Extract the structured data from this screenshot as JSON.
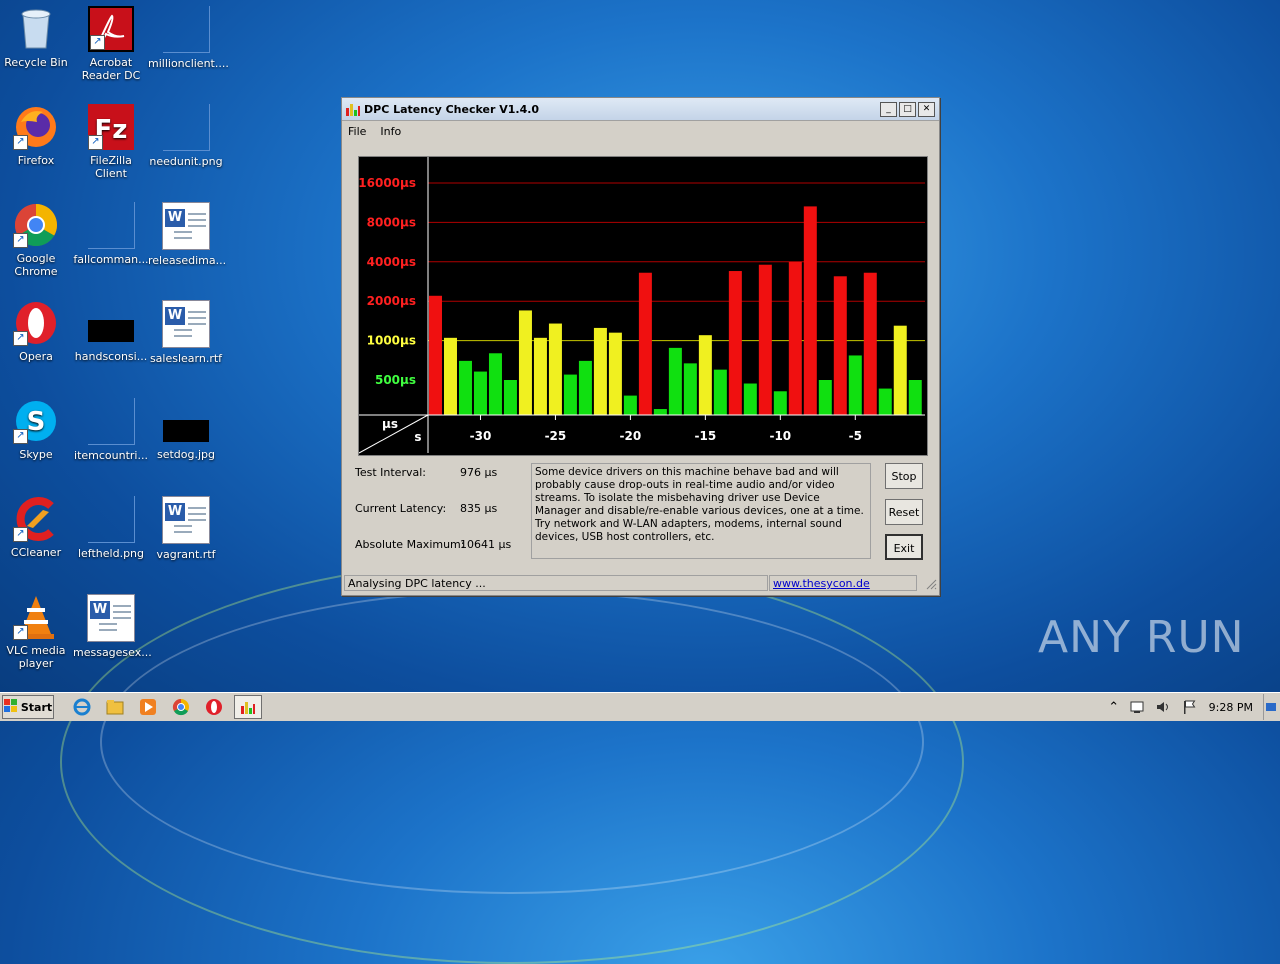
{
  "desktop": {
    "icons": [
      {
        "label": "Recycle Bin"
      },
      {
        "label": "Acrobat Reader DC"
      },
      {
        "label": "millionclient...."
      },
      {
        "label": "Firefox"
      },
      {
        "label": "FileZilla Client"
      },
      {
        "label": "needunit.png"
      },
      {
        "label": "Google Chrome"
      },
      {
        "label": "fallcomman..."
      },
      {
        "label": "releasedima..."
      },
      {
        "label": "Opera"
      },
      {
        "label": "handsconsi..."
      },
      {
        "label": "saleslearn.rtf"
      },
      {
        "label": "Skype"
      },
      {
        "label": "itemcountri..."
      },
      {
        "label": "setdog.jpg"
      },
      {
        "label": "CCleaner"
      },
      {
        "label": "leftheld.png"
      },
      {
        "label": "vagrant.rtf"
      },
      {
        "label": "VLC media player"
      },
      {
        "label": "messagesex..."
      }
    ],
    "watermark": "ANY RUN"
  },
  "window": {
    "title": "DPC Latency Checker V1.4.0",
    "menu": {
      "file": "File",
      "info": "Info"
    },
    "stats": {
      "test_interval_label": "Test Interval:",
      "test_interval_value": "976 µs",
      "current_latency_label": "Current Latency:",
      "current_latency_value": "835 µs",
      "absolute_max_label": "Absolute Maximum:",
      "absolute_max_value": "10641 µs"
    },
    "message": "Some device drivers on this machine behave bad and will probably cause drop-outs in real-time audio and/or video streams. To isolate the misbehaving driver use Device Manager and disable/re-enable various devices, one at a time. Try network and W-LAN adapters, modems, internal sound devices, USB host controllers, etc.",
    "buttons": {
      "stop": "Stop",
      "reset": "Reset",
      "exit": "Exit"
    },
    "status": "Analysing DPC latency ...",
    "link": "www.thesycon.de"
  },
  "chart_data": {
    "type": "bar",
    "y_tick_labels": [
      {
        "label": "16000µs",
        "value": 16000,
        "color": "#ff2020"
      },
      {
        "label": "8000µs",
        "value": 8000,
        "color": "#ff2020"
      },
      {
        "label": "4000µs",
        "value": 4000,
        "color": "#ff2020"
      },
      {
        "label": "2000µs",
        "value": 2000,
        "color": "#ff2020"
      },
      {
        "label": "1000µs",
        "value": 1000,
        "color": "#ffff40"
      },
      {
        "label": "500µs",
        "value": 500,
        "color": "#40ff40"
      }
    ],
    "x_tick_labels": [
      "-30",
      "-25",
      "-20",
      "-15",
      "-10",
      "-5"
    ],
    "x_ticks": [
      -30,
      -25,
      -20,
      -15,
      -10,
      -5
    ],
    "y_unit_label": "µs",
    "x_unit_label": "s",
    "x_range": [
      -33,
      0
    ],
    "scale": "log2",
    "bars": [
      {
        "x": -33,
        "value": 2200
      },
      {
        "x": -32,
        "value": 1050
      },
      {
        "x": -31,
        "value": 700
      },
      {
        "x": -30,
        "value": 580
      },
      {
        "x": -29,
        "value": 800
      },
      {
        "x": -28,
        "value": 500
      },
      {
        "x": -27,
        "value": 1700
      },
      {
        "x": -26,
        "value": 1050
      },
      {
        "x": -25,
        "value": 1350
      },
      {
        "x": -24,
        "value": 550
      },
      {
        "x": -23,
        "value": 700
      },
      {
        "x": -22,
        "value": 1250
      },
      {
        "x": -21,
        "value": 1150
      },
      {
        "x": -20,
        "value": 380
      },
      {
        "x": -19,
        "value": 3300
      },
      {
        "x": -18,
        "value": 300
      },
      {
        "x": -17,
        "value": 880
      },
      {
        "x": -16,
        "value": 670
      },
      {
        "x": -15,
        "value": 1100
      },
      {
        "x": -14,
        "value": 600
      },
      {
        "x": -13,
        "value": 3400
      },
      {
        "x": -12,
        "value": 470
      },
      {
        "x": -11,
        "value": 3800
      },
      {
        "x": -10,
        "value": 410
      },
      {
        "x": -9,
        "value": 4000
      },
      {
        "x": -8,
        "value": 10600
      },
      {
        "x": -7,
        "value": 500
      },
      {
        "x": -6,
        "value": 3100
      },
      {
        "x": -5,
        "value": 770
      },
      {
        "x": -4,
        "value": 3300
      },
      {
        "x": -3,
        "value": 430
      },
      {
        "x": -2,
        "value": 1300
      },
      {
        "x": -1,
        "value": 500
      }
    ],
    "color_thresholds": {
      "green_below": 1000,
      "yellow_below": 2000,
      "red_above": 2000
    }
  },
  "taskbar": {
    "start": "Start",
    "clock": "9:28 PM"
  }
}
